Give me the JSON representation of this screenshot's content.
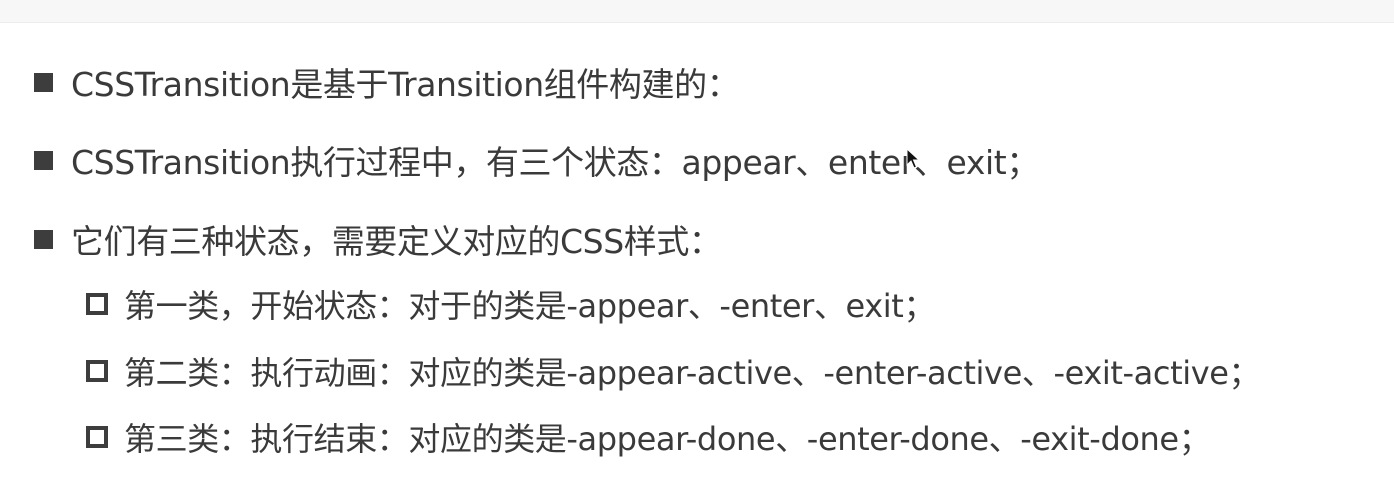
{
  "bullets": [
    {
      "text": "CSSTransition是基于Transition组件构建的："
    },
    {
      "text": "CSSTransition执行过程中，有三个状态：appear、enter、exit；"
    },
    {
      "text": "它们有三种状态，需要定义对应的CSS样式："
    }
  ],
  "sub_bullets": [
    {
      "text": "第一类，开始状态：对于的类是-appear、-enter、exit；"
    },
    {
      "text": "第二类：执行动画：对应的类是-appear-active、-enter-active、-exit-active；"
    },
    {
      "text": "第三类：执行结束：对应的类是-appear-done、-enter-done、-exit-done；"
    }
  ],
  "icons": {
    "bullet": "square-filled",
    "sub_bullet": "square-outline",
    "cursor": "mouse-pointer"
  },
  "colors": {
    "text": "#3a3a3a",
    "bullet": "#3d3d3d",
    "background": "#ffffff"
  }
}
